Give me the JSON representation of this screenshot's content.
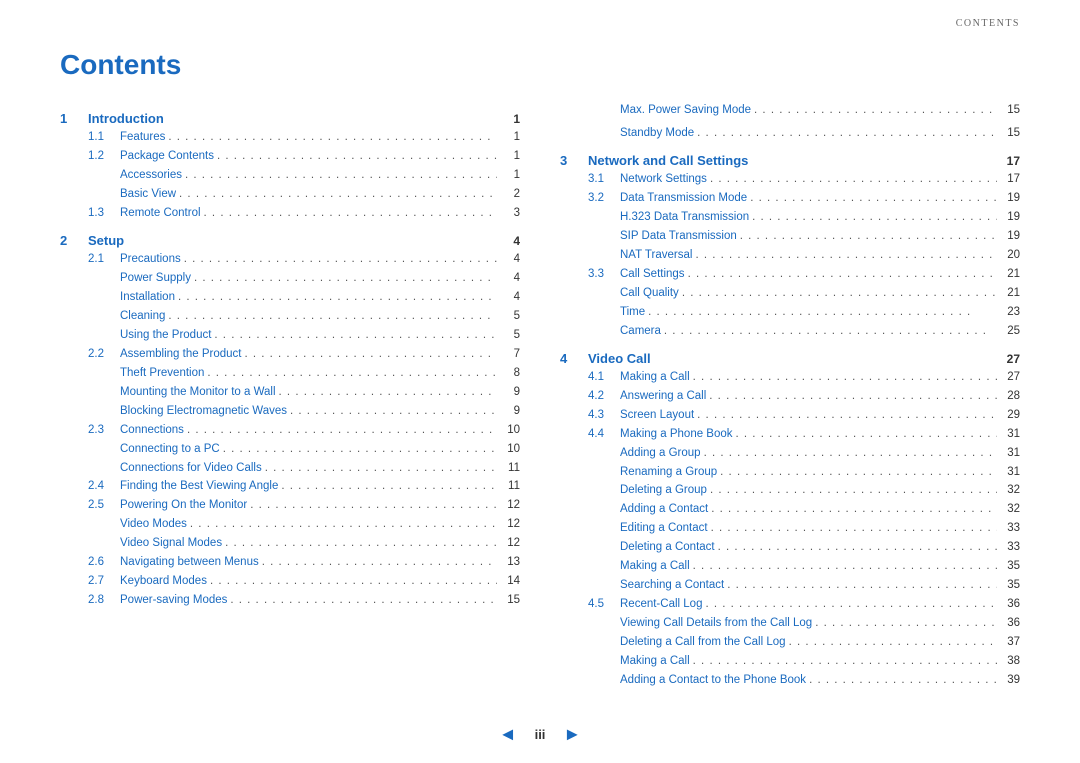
{
  "header": {
    "label": "CONTENTS"
  },
  "title": "Contents",
  "left_col": {
    "sections": [
      {
        "type": "section",
        "num": "1",
        "label": "Introduction",
        "page": "1",
        "children": [
          {
            "indent": 1,
            "sub": "1.1",
            "label": "Features",
            "page": "1"
          },
          {
            "indent": 1,
            "sub": "1.2",
            "label": "Package Contents",
            "page": "1"
          },
          {
            "indent": 2,
            "sub": "",
            "label": "Accessories",
            "page": "1"
          },
          {
            "indent": 2,
            "sub": "",
            "label": "Basic View",
            "page": "2"
          },
          {
            "indent": 1,
            "sub": "1.3",
            "label": "Remote Control",
            "page": "3"
          }
        ]
      },
      {
        "type": "section",
        "num": "2",
        "label": "Setup",
        "page": "4",
        "children": [
          {
            "indent": 1,
            "sub": "2.1",
            "label": "Precautions",
            "page": "4"
          },
          {
            "indent": 2,
            "sub": "",
            "label": "Power Supply",
            "page": "4"
          },
          {
            "indent": 2,
            "sub": "",
            "label": "Installation",
            "page": "4"
          },
          {
            "indent": 2,
            "sub": "",
            "label": "Cleaning",
            "page": "5"
          },
          {
            "indent": 2,
            "sub": "",
            "label": "Using the Product",
            "page": "5"
          },
          {
            "indent": 1,
            "sub": "2.2",
            "label": "Assembling the Product",
            "page": "7"
          },
          {
            "indent": 2,
            "sub": "",
            "label": "Theft Prevention",
            "page": "8"
          },
          {
            "indent": 2,
            "sub": "",
            "label": "Mounting the Monitor to a Wall",
            "page": "9"
          },
          {
            "indent": 2,
            "sub": "",
            "label": "Blocking Electromagnetic Waves",
            "page": "9"
          },
          {
            "indent": 1,
            "sub": "2.3",
            "label": "Connections",
            "page": "10"
          },
          {
            "indent": 2,
            "sub": "",
            "label": "Connecting to a PC",
            "page": "10"
          },
          {
            "indent": 2,
            "sub": "",
            "label": "Connections for Video Calls",
            "page": "11"
          },
          {
            "indent": 1,
            "sub": "2.4",
            "label": "Finding the Best Viewing Angle",
            "page": "11"
          },
          {
            "indent": 1,
            "sub": "2.5",
            "label": "Powering On the Monitor",
            "page": "12"
          },
          {
            "indent": 2,
            "sub": "",
            "label": "Video Modes",
            "page": "12"
          },
          {
            "indent": 2,
            "sub": "",
            "label": "Video Signal Modes",
            "page": "12"
          },
          {
            "indent": 1,
            "sub": "2.6",
            "label": "Navigating between Menus",
            "page": "13"
          },
          {
            "indent": 1,
            "sub": "2.7",
            "label": "Keyboard Modes",
            "page": "14"
          },
          {
            "indent": 1,
            "sub": "2.8",
            "label": "Power-saving Modes",
            "page": "15"
          }
        ]
      }
    ]
  },
  "right_col": {
    "top_entries": [
      {
        "label": "Max. Power Saving Mode",
        "page": "15"
      },
      {
        "label": "Standby Mode",
        "page": "15"
      }
    ],
    "sections": [
      {
        "type": "section",
        "num": "3",
        "label": "Network and Call Settings",
        "page": "17",
        "children": [
          {
            "indent": 1,
            "sub": "3.1",
            "label": "Network Settings",
            "page": "17"
          },
          {
            "indent": 1,
            "sub": "3.2",
            "label": "Data Transmission Mode",
            "page": "19"
          },
          {
            "indent": 2,
            "sub": "",
            "label": "H.323 Data Transmission",
            "page": "19"
          },
          {
            "indent": 2,
            "sub": "",
            "label": "SIP Data Transmission",
            "page": "19"
          },
          {
            "indent": 2,
            "sub": "",
            "label": "NAT Traversal",
            "page": "20"
          },
          {
            "indent": 1,
            "sub": "3.3",
            "label": "Call Settings",
            "page": "21"
          },
          {
            "indent": 2,
            "sub": "",
            "label": "Call Quality",
            "page": "21"
          },
          {
            "indent": 2,
            "sub": "",
            "label": "Time",
            "page": "23"
          },
          {
            "indent": 2,
            "sub": "",
            "label": "Camera",
            "page": "25"
          }
        ]
      },
      {
        "type": "section",
        "num": "4",
        "label": "Video Call",
        "page": "27",
        "children": [
          {
            "indent": 1,
            "sub": "4.1",
            "label": "Making a Call",
            "page": "27"
          },
          {
            "indent": 1,
            "sub": "4.2",
            "label": "Answering a Call",
            "page": "28"
          },
          {
            "indent": 1,
            "sub": "4.3",
            "label": "Screen Layout",
            "page": "29"
          },
          {
            "indent": 1,
            "sub": "4.4",
            "label": "Making a Phone Book",
            "page": "31"
          },
          {
            "indent": 2,
            "sub": "",
            "label": "Adding a Group",
            "page": "31"
          },
          {
            "indent": 2,
            "sub": "",
            "label": "Renaming a Group",
            "page": "31"
          },
          {
            "indent": 2,
            "sub": "",
            "label": "Deleting a Group",
            "page": "32"
          },
          {
            "indent": 2,
            "sub": "",
            "label": "Adding a Contact",
            "page": "32"
          },
          {
            "indent": 2,
            "sub": "",
            "label": "Editing a Contact",
            "page": "33"
          },
          {
            "indent": 2,
            "sub": "",
            "label": "Deleting a Contact",
            "page": "33"
          },
          {
            "indent": 2,
            "sub": "",
            "label": "Making a Call",
            "page": "35"
          },
          {
            "indent": 2,
            "sub": "",
            "label": "Searching a Contact",
            "page": "35"
          },
          {
            "indent": 1,
            "sub": "4.5",
            "label": "Recent-Call Log",
            "page": "36"
          },
          {
            "indent": 2,
            "sub": "",
            "label": "Viewing Call Details from the Call Log",
            "page": "36"
          },
          {
            "indent": 2,
            "sub": "",
            "label": "Deleting a Call from the Call Log",
            "page": "37"
          },
          {
            "indent": 2,
            "sub": "",
            "label": "Making a Call",
            "page": "38"
          },
          {
            "indent": 2,
            "sub": "",
            "label": "Adding a Contact to the Phone Book",
            "page": "39"
          }
        ]
      }
    ]
  },
  "footer": {
    "prev_label": "◄",
    "page_label": "iii",
    "next_label": "►"
  }
}
